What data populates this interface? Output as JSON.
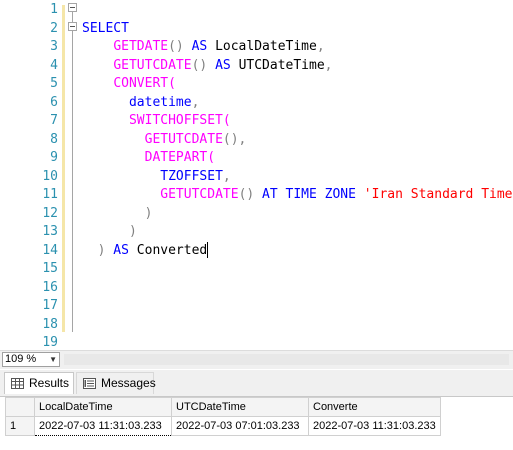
{
  "editor": {
    "line_numbers": [
      "1",
      "2",
      "3",
      "4",
      "5",
      "6",
      "7",
      "8",
      "9",
      "10",
      "11",
      "12",
      "13",
      "14",
      "15",
      "16",
      "17",
      "18",
      "19"
    ],
    "lines": [
      [],
      [
        {
          "t": "SELECT",
          "c": "kw"
        }
      ],
      [
        {
          "t": "    "
        },
        {
          "t": "GETDATE",
          "c": "fn"
        },
        {
          "t": "()",
          "c": "gy"
        },
        {
          "t": " AS ",
          "c": "kw"
        },
        {
          "t": "LocalDateTime"
        },
        {
          "t": ",",
          "c": "gy"
        }
      ],
      [
        {
          "t": "    "
        },
        {
          "t": "GETUTCDATE",
          "c": "fn"
        },
        {
          "t": "()",
          "c": "gy"
        },
        {
          "t": " AS ",
          "c": "kw"
        },
        {
          "t": "UTCDateTime"
        },
        {
          "t": ",",
          "c": "gy"
        }
      ],
      [
        {
          "t": "    "
        },
        {
          "t": "CONVERT(",
          "c": "fn"
        }
      ],
      [
        {
          "t": "      "
        },
        {
          "t": "datetime",
          "c": "kw"
        },
        {
          "t": ",",
          "c": "gy"
        }
      ],
      [
        {
          "t": "      "
        },
        {
          "t": "SWITCHOFFSET(",
          "c": "fn"
        }
      ],
      [
        {
          "t": "        "
        },
        {
          "t": "GETUTCDATE",
          "c": "fn"
        },
        {
          "t": "(),",
          "c": "gy"
        }
      ],
      [
        {
          "t": "        "
        },
        {
          "t": "DATEPART(",
          "c": "fn"
        }
      ],
      [
        {
          "t": "          "
        },
        {
          "t": "TZOFFSET",
          "c": "kw"
        },
        {
          "t": ",",
          "c": "gy"
        }
      ],
      [
        {
          "t": "          "
        },
        {
          "t": "GETUTCDATE",
          "c": "fn"
        },
        {
          "t": "()",
          "c": "gy"
        },
        {
          "t": " AT TIME ZONE ",
          "c": "kw"
        },
        {
          "t": "'Iran Standard Time'",
          "c": "st"
        }
      ],
      [
        {
          "t": "        "
        },
        {
          "t": ")",
          "c": "gy"
        }
      ],
      [
        {
          "t": "      "
        },
        {
          "t": ")",
          "c": "gy"
        }
      ],
      [
        {
          "t": "  "
        },
        {
          "t": ")",
          "c": "gy"
        },
        {
          "t": " AS ",
          "c": "kw"
        },
        {
          "t": "Converted"
        }
      ],
      [],
      [],
      [],
      [],
      []
    ]
  },
  "zoom": {
    "value": "109 %"
  },
  "tabs": [
    {
      "label": "Results",
      "icon": "grid-icon"
    },
    {
      "label": "Messages",
      "icon": "messages-icon"
    }
  ],
  "results": {
    "columns": [
      "LocalDateTime",
      "UTCDateTime",
      "Converte"
    ],
    "rows": [
      {
        "num": "1",
        "cells": [
          "2022-07-03 11:31:03.233",
          "2022-07-03 07:01:03.233",
          "2022-07-03 11:31:03.233"
        ]
      }
    ]
  }
}
